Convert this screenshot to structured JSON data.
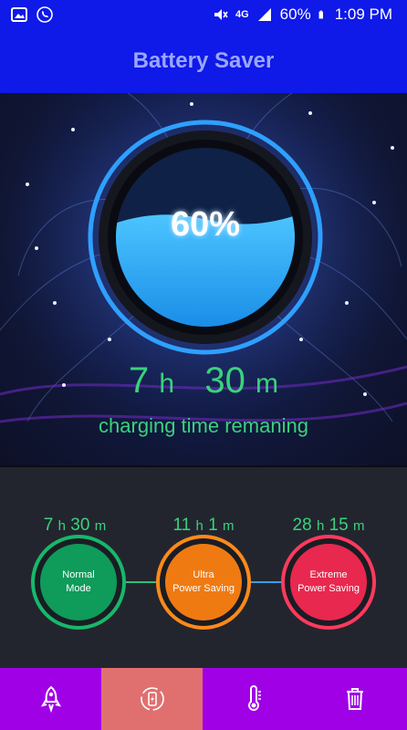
{
  "status_bar": {
    "network": "4G",
    "battery": "60%",
    "time": "1:09 PM"
  },
  "app_bar": {
    "title": "Battery Saver"
  },
  "battery": {
    "percent_label": "60%",
    "level": 0.6,
    "time_hours": "7",
    "time_h_unit": "h",
    "time_minutes": "30",
    "time_m_unit": "m",
    "subtitle": "charging time remaning"
  },
  "modes": [
    {
      "hours": "7",
      "minutes": "30",
      "h_unit": "h",
      "m_unit": "m",
      "label_line1": "Normal",
      "label_line2": "Mode",
      "color": "#0f9b5a"
    },
    {
      "hours": "11",
      "minutes": "1",
      "h_unit": "h",
      "m_unit": "m",
      "label_line1": "Ultra",
      "label_line2": "Power Saving",
      "color": "#f07a12"
    },
    {
      "hours": "28",
      "minutes": "15",
      "h_unit": "h",
      "m_unit": "m",
      "label_line1": "Extreme",
      "label_line2": "Power Saving",
      "color": "#e8284e"
    }
  ],
  "nav": {
    "items": [
      {
        "icon": "rocket-icon"
      },
      {
        "icon": "battery-charge-icon",
        "active": true
      },
      {
        "icon": "thermometer-icon"
      },
      {
        "icon": "trash-icon"
      }
    ],
    "bg_color": "#a000e6",
    "active_color": "#e07070"
  }
}
